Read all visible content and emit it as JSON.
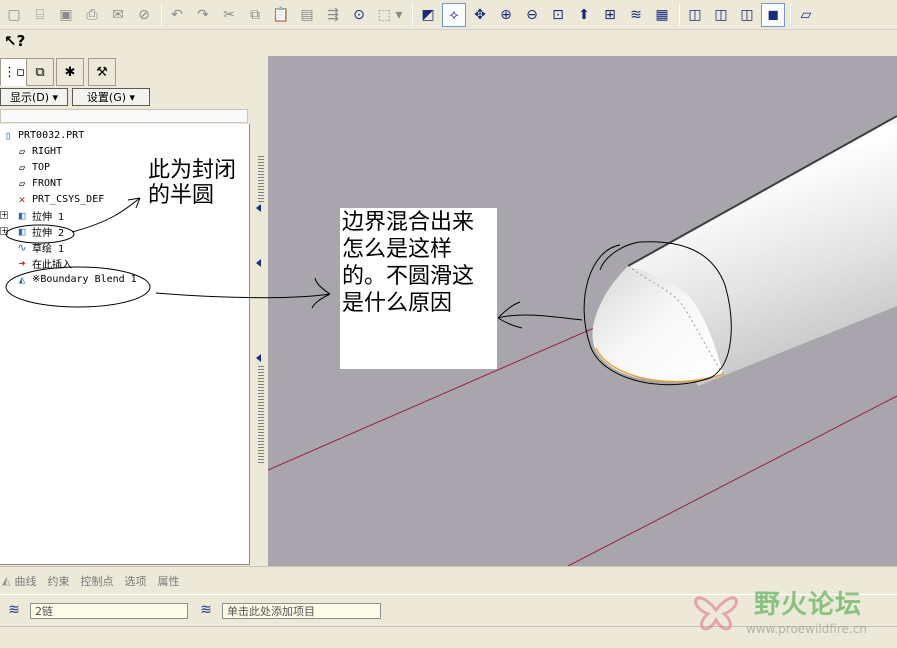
{
  "toolbar": {
    "icons": [
      "new-file-icon",
      "open-icon",
      "save-icon",
      "print-icon",
      "send-icon",
      "close-window-icon",
      "undo-icon",
      "redo-icon",
      "cut-icon",
      "copy-icon",
      "paste-icon",
      "paste-special-icon",
      "regenerate-icon",
      "find-icon",
      "select-box-icon",
      "repaint-icon",
      "spin-center-icon",
      "orient-icon",
      "zoom-in-icon",
      "zoom-out-icon",
      "refit-icon",
      "view-manager-icon",
      "saved-views-icon",
      "layers-icon",
      "model-display-icon",
      "wireframe-icon",
      "hidden-line-icon",
      "no-hidden-icon",
      "shading-icon",
      "datum-plane-icon"
    ]
  },
  "left_panel": {
    "display_menu": "显示(D)",
    "settings_menu": "设置(G)",
    "tree": [
      {
        "label": "PRT0032.PRT",
        "icon": "part-icon"
      },
      {
        "label": "RIGHT",
        "icon": "datum-plane-icon"
      },
      {
        "label": "TOP",
        "icon": "datum-plane-icon"
      },
      {
        "label": "FRONT",
        "icon": "datum-plane-icon"
      },
      {
        "label": "PRT_CSYS_DEF",
        "icon": "csys-icon"
      },
      {
        "label": "拉伸 1",
        "icon": "extrude-icon"
      },
      {
        "label": "拉伸 2",
        "icon": "extrude-icon"
      },
      {
        "label": "草绘 1",
        "icon": "sketch-icon"
      },
      {
        "label": "在此插入",
        "icon": "insert-here-icon"
      },
      {
        "label": "※Boundary Blend 1",
        "icon": "boundary-blend-icon"
      }
    ]
  },
  "annotations": {
    "left_note": "此为封闭的半圆",
    "center_note": "边界混合出来怎么是这样的。不圆滑这是什么原因"
  },
  "dashboard": {
    "tabs": [
      "曲线",
      "约束",
      "控制点",
      "选项",
      "属性"
    ],
    "chain_field": "2链",
    "add_item_field": "单击此处添加项目"
  },
  "watermark": {
    "name": "野火论坛",
    "url": "www.proewildfire.cn"
  },
  "colors": {
    "viewport_bg": "#a8a6ac",
    "datum_line": "#9a2040",
    "edge_highlight": "#e8a23a"
  }
}
